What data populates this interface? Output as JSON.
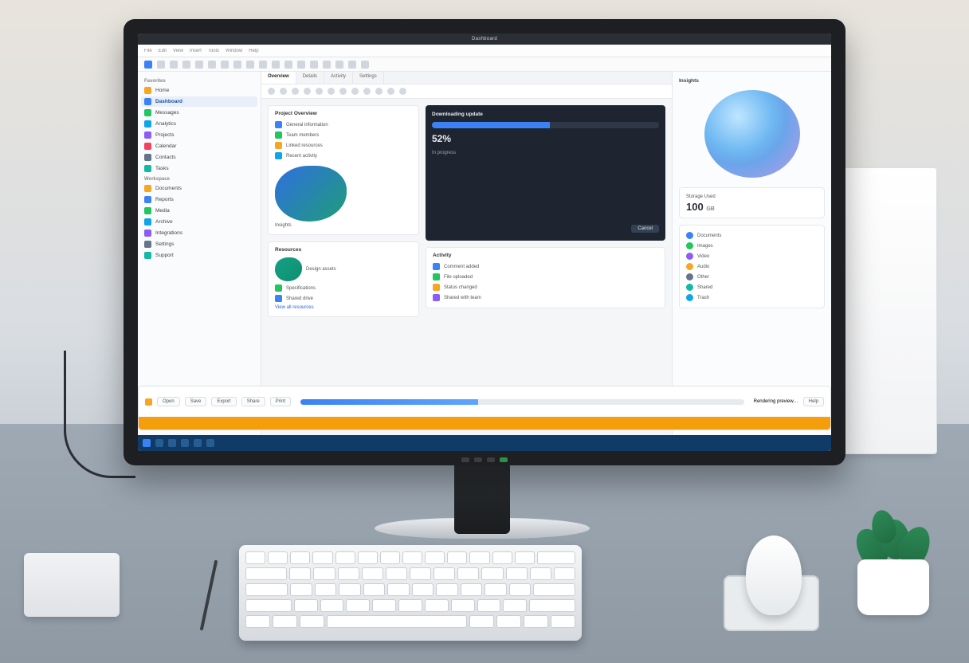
{
  "titlebar": {
    "label": "Dashboard"
  },
  "menubar": {
    "items": [
      "File",
      "Edit",
      "View",
      "Insert",
      "Tools",
      "Window",
      "Help"
    ]
  },
  "sidebar": {
    "section_a": "Favorites",
    "section_b": "Workspace",
    "items": [
      {
        "label": "Home",
        "icon": "c1"
      },
      {
        "label": "Dashboard",
        "icon": "c2",
        "selected": true
      },
      {
        "label": "Messages",
        "icon": "c3"
      },
      {
        "label": "Analytics",
        "icon": "c4"
      },
      {
        "label": "Projects",
        "icon": "c5"
      },
      {
        "label": "Calendar",
        "icon": "c6"
      },
      {
        "label": "Contacts",
        "icon": "c7"
      },
      {
        "label": "Tasks",
        "icon": "c8"
      },
      {
        "label": "Documents",
        "icon": "c1"
      },
      {
        "label": "Reports",
        "icon": "c2"
      },
      {
        "label": "Media",
        "icon": "c3"
      },
      {
        "label": "Archive",
        "icon": "c4"
      },
      {
        "label": "Integrations",
        "icon": "c5"
      },
      {
        "label": "Settings",
        "icon": "c7"
      },
      {
        "label": "Support",
        "icon": "c8"
      }
    ]
  },
  "tabs": {
    "items": [
      "Overview",
      "Details",
      "Activity",
      "Settings"
    ],
    "active": 0
  },
  "overview": {
    "title": "Project Overview",
    "rows": [
      {
        "icon": "c2",
        "label": "General information"
      },
      {
        "icon": "c3",
        "label": "Team members"
      },
      {
        "icon": "c1",
        "label": "Linked resources"
      },
      {
        "icon": "c4",
        "label": "Recent activity"
      }
    ],
    "graphic_label": "Insights"
  },
  "resources": {
    "title": "Resources",
    "rows": [
      {
        "icon": "c8",
        "label": "Design assets"
      },
      {
        "icon": "c3",
        "label": "Specifications"
      },
      {
        "icon": "c2",
        "label": "Shared drive"
      }
    ],
    "footer": "View all resources"
  },
  "modal": {
    "title": "Downloading update",
    "progress_pct": 52,
    "value_label": "52%",
    "status": "In progress",
    "action": "Cancel"
  },
  "activity": {
    "title": "Activity",
    "rows": [
      {
        "label": "Comment added"
      },
      {
        "label": "File uploaded"
      },
      {
        "label": "Status changed"
      },
      {
        "label": "Shared with team"
      }
    ]
  },
  "rightpanel": {
    "title": "Insights",
    "summary": {
      "heading": "Storage Used",
      "value": "100",
      "unit": "GB"
    },
    "list": [
      {
        "icon": "c2",
        "label": "Documents"
      },
      {
        "icon": "c3",
        "label": "Images"
      },
      {
        "icon": "c5",
        "label": "Video"
      },
      {
        "icon": "c1",
        "label": "Audio"
      },
      {
        "icon": "c7",
        "label": "Other"
      },
      {
        "icon": "c8",
        "label": "Shared"
      },
      {
        "icon": "c4",
        "label": "Trash"
      }
    ]
  },
  "bottombar": {
    "buttons": [
      "Open",
      "Save",
      "Export",
      "Share",
      "Print",
      "Help"
    ],
    "progress_pct": 40,
    "hint": "Rendering preview…"
  },
  "colors": {
    "accent": "#3b82f6",
    "success": "#22c55e",
    "warn": "#f59e0b",
    "dark": "#1e2530"
  }
}
